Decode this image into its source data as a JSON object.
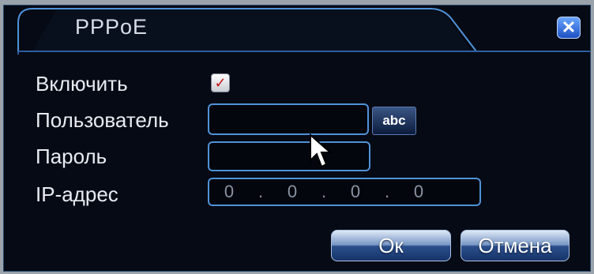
{
  "dialog": {
    "title": "PPPoE",
    "close_symbol": "✕"
  },
  "enable": {
    "label": "Включить",
    "checked": true,
    "check_symbol": "✓"
  },
  "user": {
    "label": "Пользователь",
    "value": "",
    "keyboard_button_label": "abc"
  },
  "password": {
    "label": "Пароль",
    "value": ""
  },
  "ip": {
    "label": "IP-адрес",
    "octets": [
      "0",
      "0",
      "0",
      "0"
    ],
    "separator": "."
  },
  "buttons": {
    "ok_label": "Ок",
    "cancel_label": "Отмена"
  },
  "colors": {
    "accent": "#4f92d8",
    "background": "#060a14",
    "close_button": "#2f6ae0"
  }
}
